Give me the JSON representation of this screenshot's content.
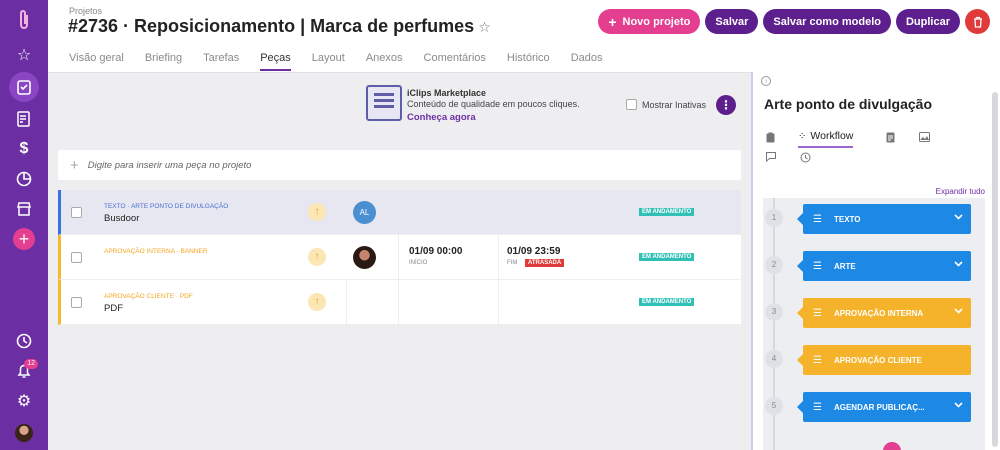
{
  "rail": {
    "badge_count": "12"
  },
  "header": {
    "breadcrumb": "Projetos",
    "title": "#2736 · Reposicionamento | Marca de perfumes",
    "buttons": {
      "new_project": "Novo projeto",
      "save": "Salvar",
      "save_as_template": "Salvar como modelo",
      "duplicate": "Duplicar"
    },
    "tabs": [
      "Visão geral",
      "Briefing",
      "Tarefas",
      "Peças",
      "Layout",
      "Anexos",
      "Comentários",
      "Histórico",
      "Dados"
    ],
    "active_tab": "Peças"
  },
  "promo": {
    "title": "iClips Marketplace",
    "subtitle": "Conteúdo de qualidade em poucos cliques.",
    "link": "Conheça agora"
  },
  "filters": {
    "show_inactive": "Mostrar Inativas"
  },
  "add_row": {
    "placeholder": "Digite para inserir uma peça no projeto"
  },
  "rows": [
    {
      "kind": "Texto · Arte ponto de divulgação",
      "name": "Busdoor",
      "avatar": "AL",
      "start": "",
      "start_label": "",
      "end": "",
      "end_label": "",
      "late": "",
      "status": "Em andamento"
    },
    {
      "kind": "Aprovação interna · Banner",
      "name": "",
      "avatar": "",
      "start": "01/09 00:00",
      "start_label": "Início",
      "end": "01/09 23:59",
      "end_label": "Fim",
      "late": "ATRASADA",
      "status": "Em andamento"
    },
    {
      "kind": "Aprovação cliente · PDF",
      "name": "PDF",
      "avatar": "",
      "start": "",
      "start_label": "",
      "end": "",
      "end_label": "",
      "late": "",
      "status": "Em andamento"
    }
  ],
  "panel": {
    "title": "Arte ponto de divulgação",
    "tab_workflow": "Workflow",
    "expand_all": "Expandir tudo",
    "steps": [
      {
        "num": "1",
        "label": "TEXTO",
        "color": "#1e88e5",
        "expandable": true
      },
      {
        "num": "2",
        "label": "ARTE",
        "color": "#1e88e5",
        "expandable": true
      },
      {
        "num": "3",
        "label": "APROVAÇÃO INTERNA",
        "color": "#f5b32b",
        "expandable": true
      },
      {
        "num": "4",
        "label": "APROVAÇÃO CLIENTE",
        "color": "#f5b32b",
        "expandable": false
      },
      {
        "num": "5",
        "label": "AGENDAR PUBLICAÇ...",
        "color": "#1e88e5",
        "expandable": true
      }
    ]
  },
  "colors": {
    "rail": "#6b2fa3",
    "accent_pink": "#e33e8f",
    "accent_purple": "#5e1f8e",
    "status_teal": "#31c0b5",
    "late_red": "#e03a3a",
    "step_blue": "#1e88e5",
    "step_orange": "#f5b32b"
  }
}
